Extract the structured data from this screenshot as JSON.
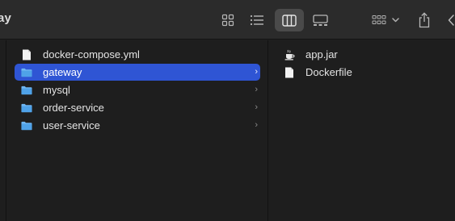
{
  "window": {
    "title_fragment": "ay"
  },
  "toolbar": {
    "buttons": [
      {
        "icon": "icon-view-grid-icon"
      },
      {
        "icon": "list-view-icon"
      },
      {
        "icon": "column-view-icon",
        "active": true
      },
      {
        "icon": "gallery-view-icon"
      },
      {
        "icon": "group-by-icon"
      },
      {
        "icon": "share-icon"
      },
      {
        "icon": "back-chevron-icon"
      }
    ]
  },
  "column_main": {
    "items": [
      {
        "name": "docker-compose.yml",
        "kind": "file",
        "has_children": false
      },
      {
        "name": "gateway",
        "kind": "folder",
        "has_children": true,
        "selected": true
      },
      {
        "name": "mysql",
        "kind": "folder",
        "has_children": true
      },
      {
        "name": "order-service",
        "kind": "folder",
        "has_children": true
      },
      {
        "name": "user-service",
        "kind": "folder",
        "has_children": true
      }
    ]
  },
  "column_preview": {
    "items": [
      {
        "name": "app.jar",
        "kind": "java-archive"
      },
      {
        "name": "Dockerfile",
        "kind": "file"
      }
    ]
  },
  "colors": {
    "selection": "#2f55d4",
    "folder": "#5ba9ec",
    "background": "#1e1e1e",
    "toolbar": "#2b2b2b"
  }
}
